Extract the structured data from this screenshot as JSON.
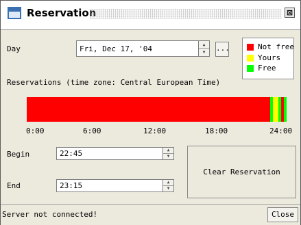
{
  "window": {
    "title": "Reservation",
    "close_glyph": "⊠"
  },
  "day": {
    "label": "Day",
    "value": "Fri, Dec 17, '04",
    "picker_label": "..."
  },
  "legend": [
    {
      "label": "Not free",
      "color": "#ff0000"
    },
    {
      "label": "Yours",
      "color": "#ffff00"
    },
    {
      "label": "Free",
      "color": "#00ff00"
    }
  ],
  "reservations_heading": "Reservations (time zone: Central European Time)",
  "timeline": {
    "colors": {
      "not_free": "#ff0000",
      "yours": "#ffff00",
      "free": "#00ff00"
    },
    "segments": [
      {
        "status": "free",
        "start_hour": 22.5,
        "end_hour": 22.75
      },
      {
        "status": "yours",
        "start_hour": 22.75,
        "end_hour": 23.25
      },
      {
        "status": "free",
        "start_hour": 23.25,
        "end_hour": 23.5
      },
      {
        "status": "free",
        "start_hour": 23.75,
        "end_hour": 24.0
      }
    ],
    "ticks": [
      "0:00",
      "6:00",
      "12:00",
      "18:00",
      "24:00"
    ]
  },
  "begin": {
    "label": "Begin",
    "value": "22:45"
  },
  "end": {
    "label": "End",
    "value": "23:15"
  },
  "clear_button": {
    "label": "Clear Reservation"
  },
  "status": {
    "message": "Server not connected!"
  },
  "close_button": {
    "label": "Close"
  },
  "icons": {
    "spin_up": "▲",
    "spin_down": "▼"
  }
}
